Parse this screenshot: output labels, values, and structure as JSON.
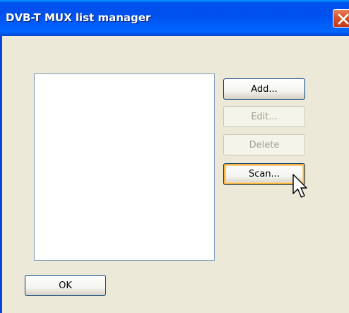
{
  "window": {
    "title": "DVB-T MUX list manager"
  },
  "listbox": {
    "items": []
  },
  "buttons": {
    "add": "Add...",
    "edit": "Edit...",
    "delete": "Delete",
    "scan": "Scan...",
    "ok": "OK"
  },
  "states": {
    "edit_enabled": false,
    "delete_enabled": false,
    "scan_hovered": true
  },
  "icons": {
    "close": "close-icon",
    "cursor": "mouse-pointer-icon"
  },
  "colors": {
    "titlebar": "#0054e3",
    "dialog_background": "#ece9d8",
    "close_button": "#d8522c",
    "hover_highlight": "#f8b33e",
    "disabled_text": "#a1a192"
  }
}
